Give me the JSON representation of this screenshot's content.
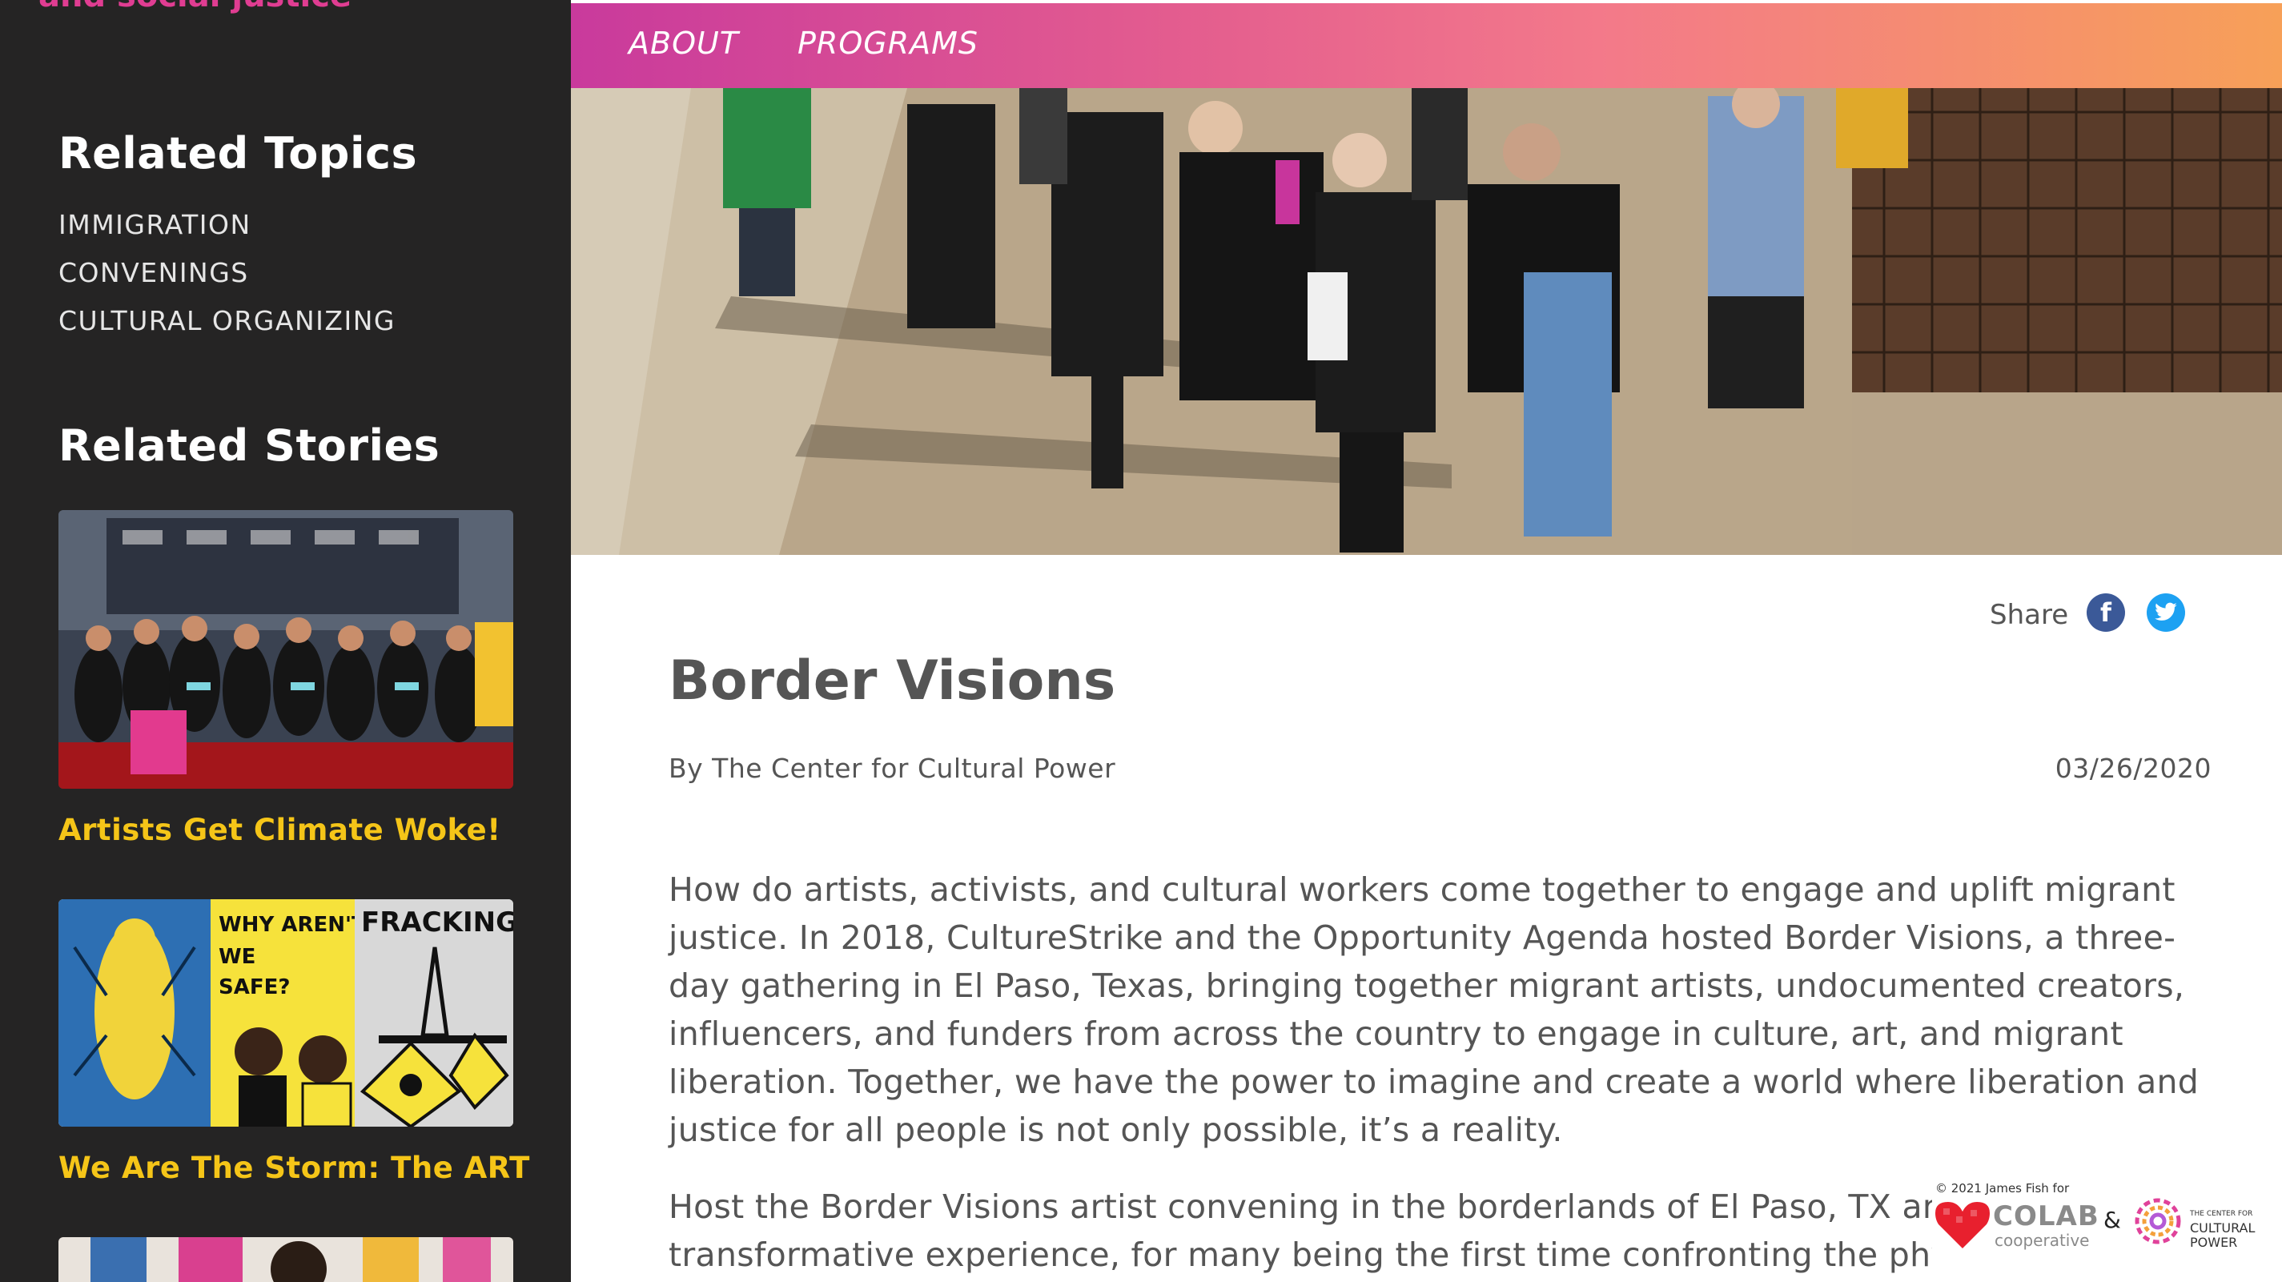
{
  "sidebar": {
    "tagline_clipped": "and social justice",
    "related_topics_title": "Related Topics",
    "topics": [
      "IMMIGRATION",
      "CONVENINGS",
      "CULTURAL ORGANIZING"
    ],
    "related_stories_title": "Related Stories",
    "stories": [
      {
        "title": "Artists Get Climate Woke!"
      },
      {
        "title": "We Are The Storm: The ART"
      }
    ]
  },
  "nav": {
    "about": "ABOUT",
    "programs": "PROGRAMS"
  },
  "article": {
    "share_label": "Share",
    "facebook_glyph": "f",
    "title": "Border Visions",
    "byline": "By The Center for Cultural Power",
    "date": "03/26/2020",
    "paragraphs": [
      "How do artists, activists, and cultural workers come together to engage and uplift migrant justice. In 2018, CultureStrike and the Opportunity Agenda hosted Border Visions, a three-day gathering in El Paso, Texas, bringing together migrant artists, undocumented creators, influencers, and funders from across the country to engage in culture, art, and migrant liberation. Together, we have the power to imagine and create a world where liberation and justice for all people is not only possible, it’s a reality.",
      "Host the Border Visions artist convening in the borderlands of El Paso, TX and transformative experience, for many being the first time confronting the physical"
    ]
  },
  "credit": {
    "copyright": "© 2021 James Fish for",
    "colab": "COLAB",
    "cooperative": "cooperative",
    "ampersand": "&",
    "ccp_small": "THE CENTER FOR",
    "ccp_line1": "CULTURAL",
    "ccp_line2": "POWER"
  },
  "colors": {
    "sidebar_bg": "#252424",
    "story_title": "#f5c518",
    "nav_gradient_start": "#c93a9c",
    "nav_gradient_end": "#f7a058",
    "text": "#555555",
    "facebook": "#3b5998",
    "twitter": "#1da1f2"
  },
  "icons": [
    "facebook-icon",
    "twitter-icon",
    "colab-heart-logo",
    "center-for-cultural-power-logo"
  ]
}
